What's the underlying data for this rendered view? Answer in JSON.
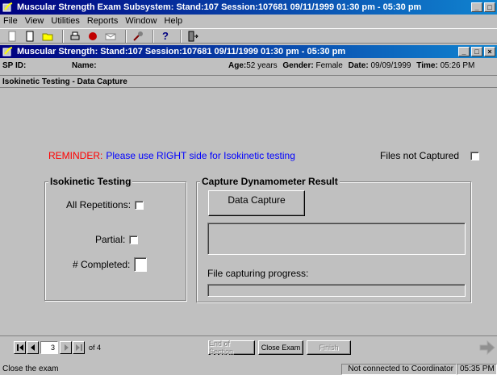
{
  "window": {
    "title": "Muscular Strength Exam Subsystem: Stand:107 Session:107681 09/11/1999 01:30 pm - 05:30 pm"
  },
  "menu": {
    "items": [
      "File",
      "View",
      "Utilities",
      "Reports",
      "Window",
      "Help"
    ]
  },
  "child_window": {
    "title": "Muscular Strength: Stand:107 Session:107681 09/11/1999 01:30 pm - 05:30 pm"
  },
  "info": {
    "sp_id_label": "SP ID:",
    "name_label": "Name:",
    "age_label": "Age:",
    "age_value": "52 years",
    "gender_label": "Gender:",
    "gender_value": "Female",
    "date_label": "Date:",
    "date_value": "09/09/1999",
    "time_label": "Time:",
    "time_value": "05:26 PM"
  },
  "section": {
    "title": "Isokinetic Testing - Data Capture"
  },
  "reminder": {
    "label": "REMINDER:",
    "message": "Please use RIGHT side for Isokinetic testing"
  },
  "files_not_captured": {
    "label": "Files not Captured"
  },
  "isokinetic": {
    "title": "Isokinetic Testing",
    "all_repetitions_label": "All Repetitions:",
    "partial_label": "Partial:",
    "completed_label": "# Completed:"
  },
  "capture": {
    "title": "Capture Dynamometer Result",
    "button_label": "Data Capture",
    "progress_label": "File capturing progress:"
  },
  "nav": {
    "page": "3",
    "of_label": "of 4",
    "end_of_section": "End of Section",
    "close_exam": "Close Exam",
    "finish": "Finish"
  },
  "status": {
    "message": "Close the exam",
    "connection": "Not connected to Coordinator",
    "clock": "05:35 PM"
  },
  "colors": {
    "titlebar": "#000080",
    "reminder_label": "#ff0000",
    "reminder_message": "#0000ff"
  }
}
